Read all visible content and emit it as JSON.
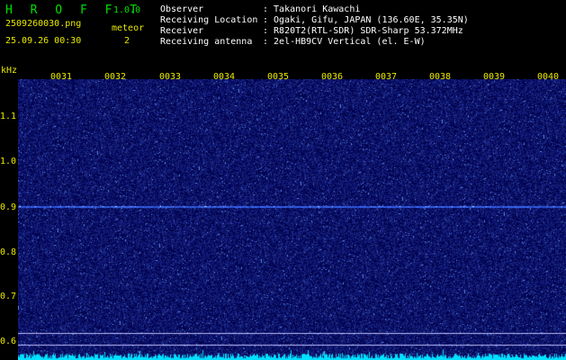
{
  "header": {
    "app_title": "H R O F F T",
    "version": "1.0.0",
    "filename": "2509260030.png",
    "timestamp": "25.09.26 00:30",
    "meteor_label": "meteor",
    "meteor_count": "2"
  },
  "station": {
    "rows": [
      {
        "label": "Observer",
        "value": ": Takanori Kawachi"
      },
      {
        "label": "Receiving Location",
        "value": ": Ogaki, Gifu, JAPAN (136.60E, 35.35N)"
      },
      {
        "label": "Receiver",
        "value": ": R820T2(RTL-SDR) SDR-Sharp 53.372MHz"
      },
      {
        "label": "Receiving antenna",
        "value": ": 2el-HB9CV Vertical (el. E-W)"
      }
    ]
  },
  "axes": {
    "y_unit": "kHz",
    "y_ticks": [
      "1.1",
      "1.0",
      "0.9",
      "0.8",
      "0.7",
      "0.6"
    ],
    "x_ticks": [
      "0031",
      "0032",
      "0033",
      "0034",
      "0035",
      "0036",
      "0037",
      "0038",
      "0039",
      "0040"
    ]
  },
  "colors": {
    "background": "#000000",
    "spectrogram_base": "#101060",
    "signal_line": "#3060ff",
    "noise_trace": "#00e0ff",
    "reference_line": "#c0c0ff"
  },
  "spectrogram": {
    "carrier_khz": 0.9,
    "y_range_khz": [
      0.58,
      1.18
    ],
    "time_range_min": [
      "0030",
      "0040"
    ]
  }
}
